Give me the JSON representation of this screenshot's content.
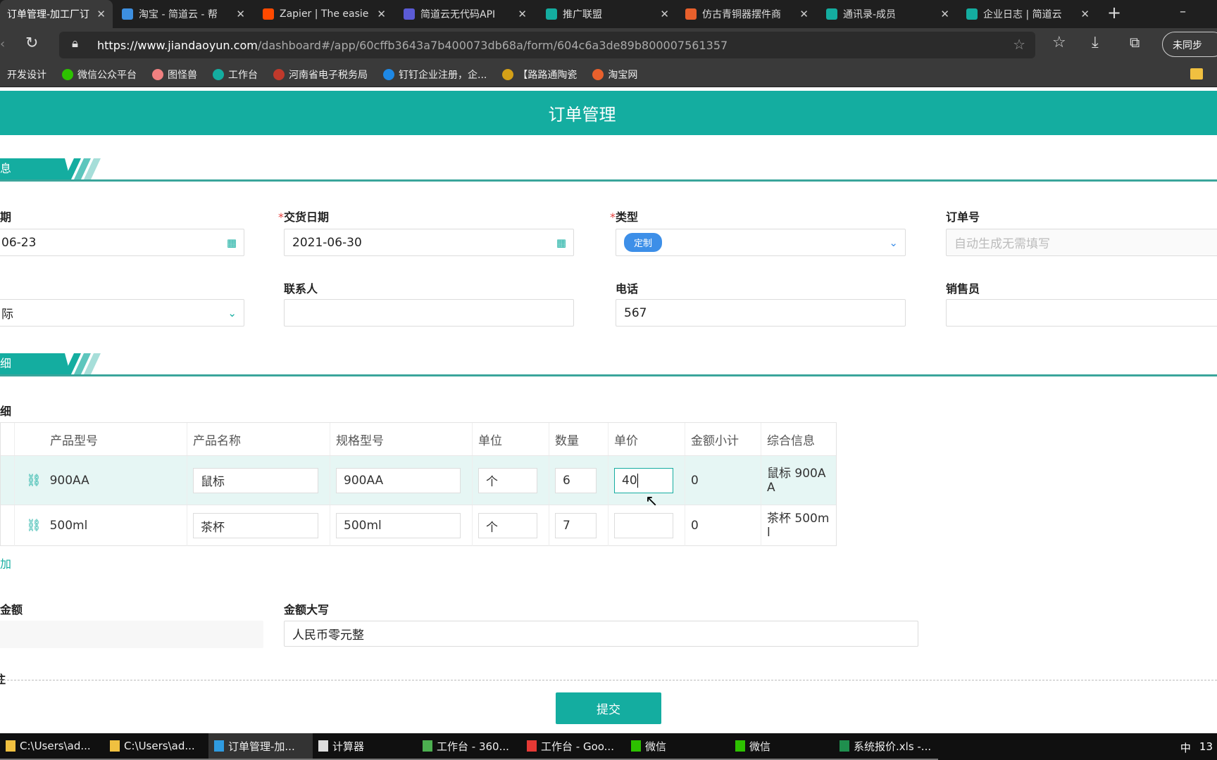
{
  "browser": {
    "tabs": [
      {
        "title": "订单管理-加工厂订",
        "color": "#14ada0",
        "active": true
      },
      {
        "title": "淘宝 - 简道云 - 帮",
        "color": "#3d8fe0"
      },
      {
        "title": "Zapier | The easie",
        "color": "#ff4a00"
      },
      {
        "title": "简道云无代码API",
        "color": "#5b5bd6"
      },
      {
        "title": "推广联盟",
        "color": "#14ada0"
      },
      {
        "title": "仿古青铜器摆件商",
        "color": "#e8602c"
      },
      {
        "title": "通讯录-成员",
        "color": "#14ada0"
      },
      {
        "title": "企业日志 | 简道云",
        "color": "#14ada0"
      }
    ],
    "url_host": "https://www.jiandaoyun.com",
    "url_path": "/dashboard#/app/60cffb3643a7b400073db68a/form/604c6a3de89b800007561357",
    "sync_label": "未同步",
    "bookmarks": [
      {
        "label": "开发设计",
        "color": ""
      },
      {
        "label": "微信公众平台",
        "color": "#2dc100"
      },
      {
        "label": "图怪兽",
        "color": "#f08080"
      },
      {
        "label": "工作台",
        "color": "#14ada0"
      },
      {
        "label": "河南省电子税务局",
        "color": "#c0392b"
      },
      {
        "label": "钉钉企业注册，企...",
        "color": "#1e88e5"
      },
      {
        "label": "【路路通陶瓷",
        "color": "#d4a017"
      },
      {
        "label": "淘宝网",
        "color": "#e8602c"
      }
    ]
  },
  "header": {
    "title": "订单管理"
  },
  "sections": [
    {
      "title": "息"
    },
    {
      "title": "细"
    }
  ],
  "fields": {
    "order_date": {
      "label": "期",
      "value": "06-23"
    },
    "delivery_date": {
      "label": "交货日期",
      "value": "2021-06-30"
    },
    "type": {
      "label": "类型",
      "value": "定制"
    },
    "order_no": {
      "label": "订单号",
      "placeholder": "自动生成无需填写"
    },
    "customer": {
      "value": "际"
    },
    "contact": {
      "label": "联系人",
      "value": ""
    },
    "phone": {
      "label": "电话",
      "value": "567"
    },
    "salesperson": {
      "label": "销售员",
      "value": ""
    },
    "total": {
      "label": "金额",
      "value": ""
    },
    "total_caps": {
      "label": "金额大写",
      "value": "人民币零元整"
    },
    "remark_label": "注"
  },
  "details": {
    "label": "细",
    "add_label": "加",
    "columns": [
      "产品型号",
      "产品名称",
      "规格型号",
      "单位",
      "数量",
      "单价",
      "金额小计",
      "综合信息"
    ],
    "rows": [
      {
        "model": "900AA",
        "name": "鼠标",
        "spec": "900AA",
        "unit": "个",
        "qty": "6",
        "price": "40",
        "subtotal": "0",
        "info": "鼠标 900AA"
      },
      {
        "model": "500ml",
        "name": "茶杯",
        "spec": "500ml",
        "unit": "个",
        "qty": "7",
        "price": "",
        "subtotal": "0",
        "info": "茶杯 500ml"
      }
    ]
  },
  "submit_label": "提交",
  "taskbar": [
    {
      "label": "C:\\Users\\ad...",
      "color": "#f0c040"
    },
    {
      "label": "C:\\Users\\ad...",
      "color": "#f0c040"
    },
    {
      "label": "订单管理-加...",
      "color": "#2f9be0",
      "active": true
    },
    {
      "label": "计算器",
      "color": "#ddd"
    },
    {
      "label": "工作台 - 360...",
      "color": "#4caf50"
    },
    {
      "label": "工作台 - Goo...",
      "color": "#e53935"
    },
    {
      "label": "微信",
      "color": "#2dc100"
    },
    {
      "label": "微信",
      "color": "#2dc100"
    },
    {
      "label": "系统报价.xls -...",
      "color": "#1f8f4e"
    }
  ],
  "tray": {
    "ime": "中",
    "clock": "13"
  }
}
